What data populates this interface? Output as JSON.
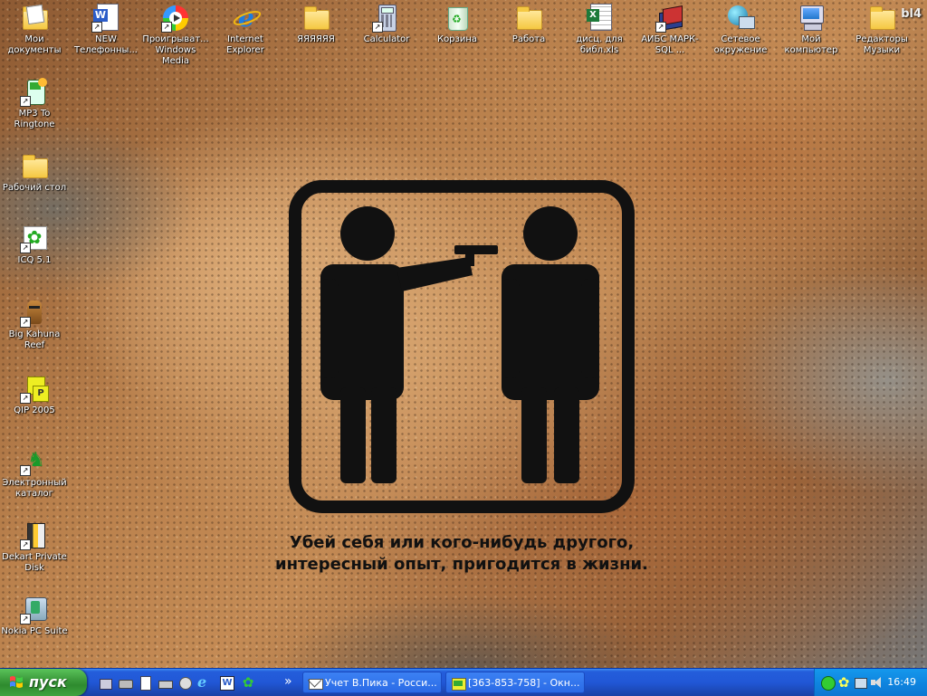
{
  "desktop": {
    "icons": [
      {
        "label": "Мои документы",
        "icon": "my-documents-icon"
      },
      {
        "label": "NEW Телефонны...",
        "icon": "word-document-icon"
      },
      {
        "label": "Проигрыват... Windows Media",
        "icon": "windows-media-player-icon"
      },
      {
        "label": "Internet Explorer",
        "icon": "internet-explorer-icon"
      },
      {
        "label": "ЯЯЯЯЯЯ",
        "icon": "folder-icon"
      },
      {
        "label": "Calculator",
        "icon": "calculator-icon"
      },
      {
        "label": "Корзина",
        "icon": "recycle-bin-icon"
      },
      {
        "label": "Работа",
        "icon": "folder-icon"
      },
      {
        "label": "дисц. для библ.xls",
        "icon": "excel-file-icon"
      },
      {
        "label": "АИБС МАРК-SQL ...",
        "icon": "books-icon"
      },
      {
        "label": "Сетевое окружение",
        "icon": "network-places-icon"
      },
      {
        "label": "Мой компьютер",
        "icon": "my-computer-icon"
      },
      {
        "label": "Редакторы Музыки",
        "icon": "folder-icon"
      },
      {
        "label": "MP3 To Ringtone",
        "icon": "mp3-ringtone-icon"
      },
      {
        "label": "Рабочий стол",
        "icon": "folder-icon"
      },
      {
        "label": "ICQ 5.1",
        "icon": "icq-flower-icon"
      },
      {
        "label": "Big Kahuna Reef",
        "icon": "tiki-mask-icon"
      },
      {
        "label": "QIP 2005",
        "icon": "qip-icon"
      },
      {
        "label": "Электронный каталог",
        "icon": "catalog-icon"
      },
      {
        "label": "Dekart Private Disk",
        "icon": "private-disk-icon"
      },
      {
        "label": "Nokia PC Suite",
        "icon": "nokia-pc-suite-icon"
      }
    ],
    "corner_text": "bl4",
    "poster_caption_line1": "Убей себя или кого-нибудь другого,",
    "poster_caption_line2": "интересный опыт, пригодится в жизни."
  },
  "taskbar": {
    "start_label": "пуск",
    "quick_launch_overflow": "»",
    "tasks": [
      {
        "label": "Учет В.Пика - Росси...",
        "icon": "mail-envelope-icon"
      },
      {
        "label": "[363-853-758] - Окн...",
        "icon": "chat-window-icon"
      }
    ],
    "clock": "16:49"
  },
  "colors": {
    "taskbar_blue": "#245edb",
    "start_green": "#3c9b3c",
    "tray_blue": "#0f86e0"
  }
}
